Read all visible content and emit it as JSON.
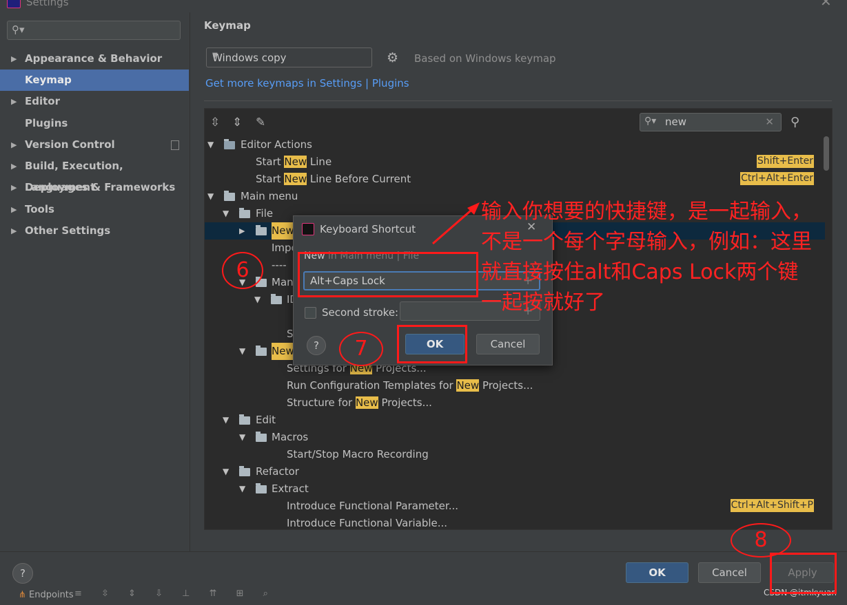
{
  "window": {
    "title": "Settings"
  },
  "sidebar": {
    "search_placeholder": "",
    "items": [
      {
        "label": "Appearance & Behavior",
        "expandable": true
      },
      {
        "label": "Keymap",
        "selected": true
      },
      {
        "label": "Editor",
        "expandable": true
      },
      {
        "label": "Plugins"
      },
      {
        "label": "Version Control",
        "expandable": true
      },
      {
        "label": "Build, Execution, Deployment",
        "expandable": true
      },
      {
        "label": "Languages & Frameworks",
        "expandable": true
      },
      {
        "label": "Tools",
        "expandable": true
      },
      {
        "label": "Other Settings",
        "expandable": true
      }
    ]
  },
  "keymap": {
    "heading": "Keymap",
    "selected": "Windows copy",
    "based_on": "Based on Windows keymap",
    "get_more": "Get more keymaps in Settings | Plugins",
    "search_value": "new"
  },
  "tree": {
    "rows": [
      {
        "pre": "Editor Actions"
      },
      {
        "pre": "Start ",
        "hl": "New",
        "post": " Line",
        "shortcut": "Shift+Enter"
      },
      {
        "pre": "Start ",
        "hl": "New",
        "post": " Line Before Current",
        "shortcut": "Ctrl+Alt+Enter"
      },
      {
        "pre": "Main menu"
      },
      {
        "pre": "File"
      },
      {
        "hl": "New"
      },
      {
        "pre": "Impo"
      },
      {
        "pre": "----"
      },
      {
        "pre": "Man"
      },
      {
        "pre": "ID"
      },
      {
        "pre": "S"
      },
      {
        "hl": "New"
      },
      {
        "pre": "Settings for ",
        "hl": "New",
        "post": " Projects..."
      },
      {
        "pre": "Run Configuration Templates for ",
        "hl": "New",
        "post": " Projects..."
      },
      {
        "pre": "Structure for ",
        "hl": "New",
        "post": " Projects..."
      },
      {
        "pre": "Edit"
      },
      {
        "pre": "Macros"
      },
      {
        "pre": "Start/Stop Macro Recording"
      },
      {
        "pre": "Refactor"
      },
      {
        "pre": "Extract"
      },
      {
        "pre": "Introduce Functional Parameter...",
        "shortcut": "Ctrl+Alt+Shift+P"
      },
      {
        "pre": "Introduce Functional Variable..."
      }
    ]
  },
  "dialog": {
    "title": "Keyboard Shortcut",
    "subtitle_action": "New",
    "subtitle_path": " in Main menu | File",
    "first_stroke": "Alt+Caps Lock",
    "second_stroke_label": "Second stroke:",
    "ok": "OK",
    "cancel": "Cancel",
    "help": "?"
  },
  "footer": {
    "help": "?",
    "ok": "OK",
    "cancel": "Cancel",
    "apply": "Apply"
  },
  "statusbar": {
    "endpoints": "Endpoints",
    "watermark": "CSDN @itmkyuan"
  },
  "annotations": {
    "step6": "6",
    "step7": "7",
    "step8": "8",
    "note": "输入你想要的快捷键，是一起输入，不是一个每个字母输入，例如：这里就直接按住alt和Caps Lock两个键一起按就好了"
  },
  "colors": {
    "accent": "#4a6da6",
    "highlight": "#e8bd4a",
    "link": "#589df6",
    "annotation": "#ff1a1a"
  }
}
